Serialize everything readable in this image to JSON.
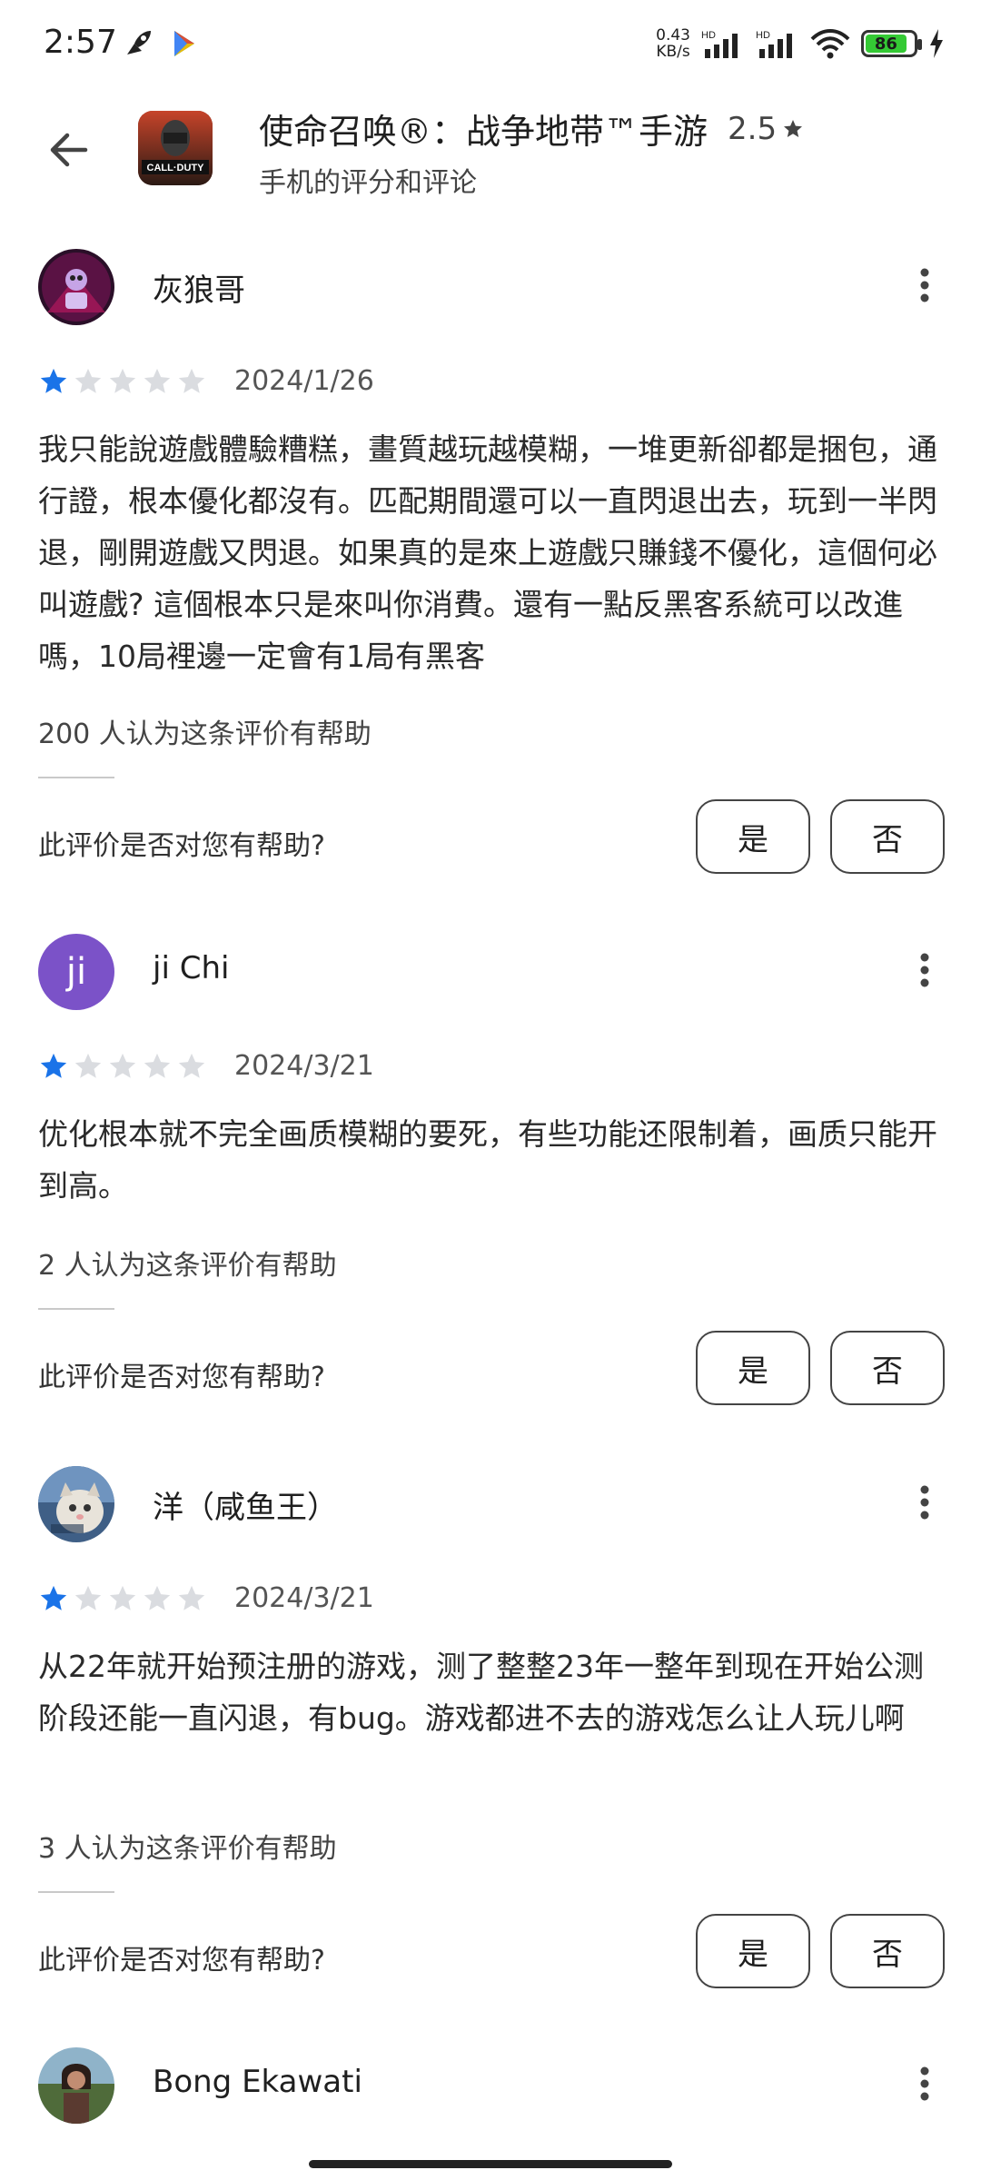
{
  "status_bar": {
    "time": "2:57",
    "net_speed_value": "0.43",
    "net_speed_unit": "KB/s",
    "battery_level": "86"
  },
  "header": {
    "app_name": "使命召唤®：战争地带™手游",
    "rating": "2.5",
    "subtitle": "手机的评分和评论"
  },
  "helpful_question": "此评价是否对您有帮助?",
  "yes_label": "是",
  "no_label": "否",
  "reviews": [
    {
      "name": "灰狼哥",
      "stars": 1,
      "date": "2024/1/26",
      "text": "我只能說遊戲體驗糟糕，畫質越玩越模糊，一堆更新卻都是捆包，通行證，根本優化都沒有。匹配期間還可以一直閃退出去，玩到一半閃退，剛開遊戲又閃退。如果真的是來上遊戲只賺錢不優化，這個何必叫遊戲? 這個根本只是來叫你消費。還有一點反黑客系統可以改進嗎，10局裡邊一定會有1局有黑客",
      "helpful": "200 人认为这条评价有帮助"
    },
    {
      "name": "ji Chi",
      "avatar_letter": "ji",
      "stars": 1,
      "date": "2024/3/21",
      "text": "优化根本就不完全画质模糊的要死，有些功能还限制着，画质只能开到高。",
      "helpful": "2 人认为这条评价有帮助"
    },
    {
      "name": "洋（咸鱼王）",
      "stars": 1,
      "date": "2024/3/21",
      "text": "从22年就开始预注册的游戏，测了整整23年一整年到现在开始公测阶段还能一直闪退，有bug。游戏都进不去的游戏怎么让人玩儿啊",
      "helpful": "3 人认为这条评价有帮助"
    },
    {
      "name": "Bong Ekawati"
    }
  ],
  "colors": {
    "star_filled": "#1a73e8",
    "star_empty": "#dadce0",
    "avatar_purple": "#7b52c8"
  }
}
